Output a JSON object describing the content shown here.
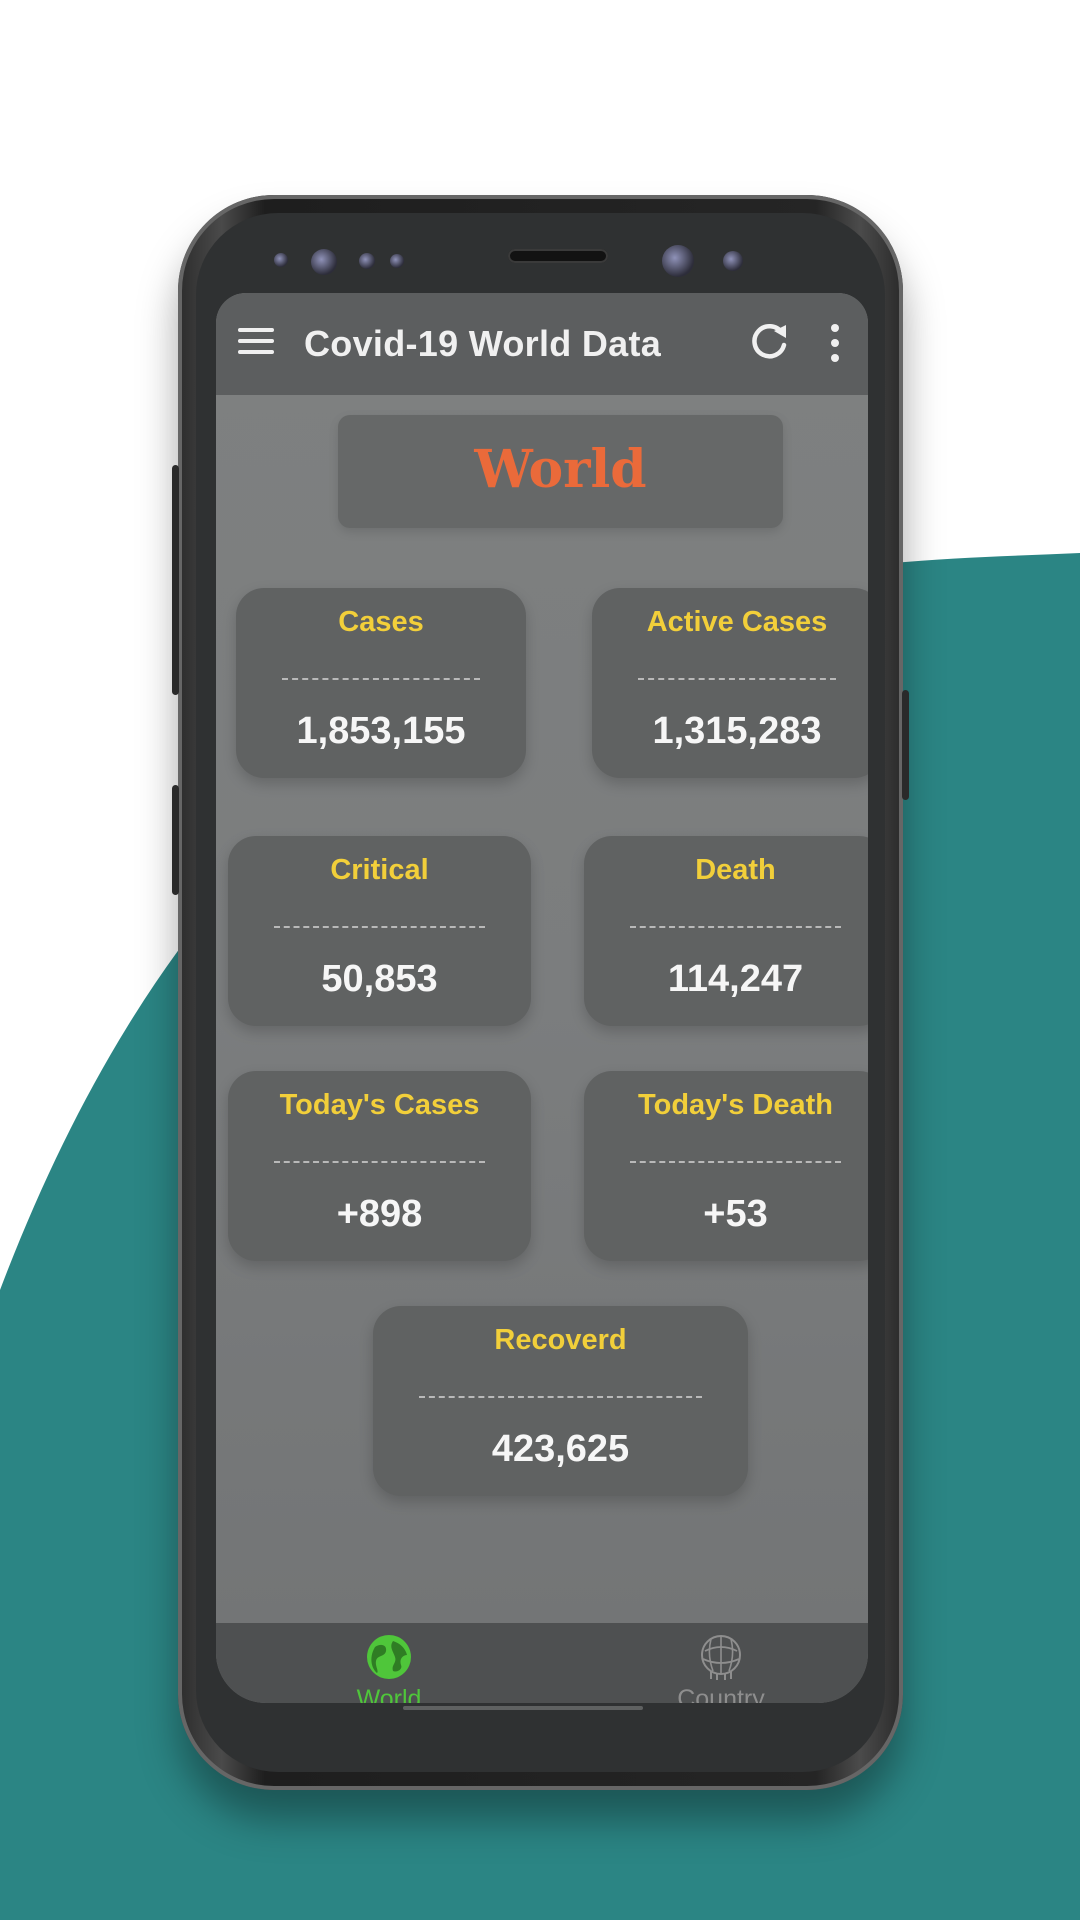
{
  "colors": {
    "teal_background": "#2b8584",
    "accent_orange": "#ea6a3a",
    "label_yellow": "#f2cf3a",
    "active_green": "#4fc63a"
  },
  "appbar": {
    "title": "Covid-19 World Data",
    "icons": [
      "menu-icon",
      "refresh-icon",
      "more-vert-icon"
    ]
  },
  "region": {
    "title": "World"
  },
  "stats": [
    {
      "label": "Cases",
      "value": "1,853,155"
    },
    {
      "label": "Active Cases",
      "value": "1,315,283"
    },
    {
      "label": "Critical",
      "value": "50,853"
    },
    {
      "label": "Death",
      "value": "114,247"
    },
    {
      "label": "Today's Cases",
      "value": "+898"
    },
    {
      "label": "Today's Death",
      "value": "+53"
    },
    {
      "label": "Recoverd",
      "value": "423,625"
    }
  ],
  "bottom_nav": {
    "items": [
      {
        "label": "World",
        "icon": "globe-icon",
        "active": true
      },
      {
        "label": "Country",
        "icon": "country-icon",
        "active": false
      }
    ]
  }
}
